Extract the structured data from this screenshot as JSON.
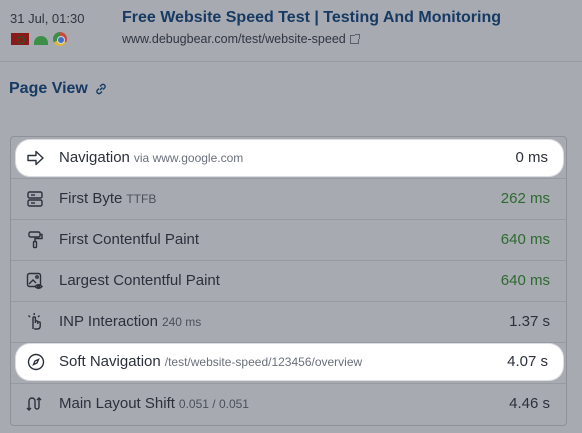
{
  "header": {
    "date": "31 Jul, 01:30",
    "title": "Free Website Speed Test | Testing And Monitoring",
    "url": "www.debugbear.com/test/website-speed",
    "icons": [
      "flag-icon",
      "android-icon",
      "chrome-icon"
    ]
  },
  "section": {
    "title": "Page View",
    "link_icon": "link-icon"
  },
  "rows": [
    {
      "icon": "arrow-right-icon",
      "label": "Navigation",
      "sub": "via www.google.com",
      "value": "0 ms",
      "highlighted": true
    },
    {
      "icon": "server-icon",
      "label": "First Byte",
      "sub": "TTFB",
      "value": "262 ms",
      "status": "good"
    },
    {
      "icon": "paint-roller-icon",
      "label": "First Contentful Paint",
      "sub": "",
      "value": "640 ms",
      "status": "good"
    },
    {
      "icon": "image-eye-icon",
      "label": "Largest Contentful Paint",
      "sub": "",
      "value": "640 ms",
      "status": "good"
    },
    {
      "icon": "tap-hand-icon",
      "label": "INP Interaction",
      "sub": "240 ms",
      "value": "1.37 s"
    },
    {
      "icon": "compass-icon",
      "label": "Soft Navigation",
      "sub": "/test/website-speed/123456/overview",
      "value": "4.07 s",
      "highlighted": true
    },
    {
      "icon": "layout-shift-icon",
      "label": "Main Layout Shift",
      "sub": "0.051 / 0.051",
      "value": "4.46 s"
    }
  ],
  "colors": {
    "good": "#2d6a2f",
    "title": "#173a63"
  }
}
